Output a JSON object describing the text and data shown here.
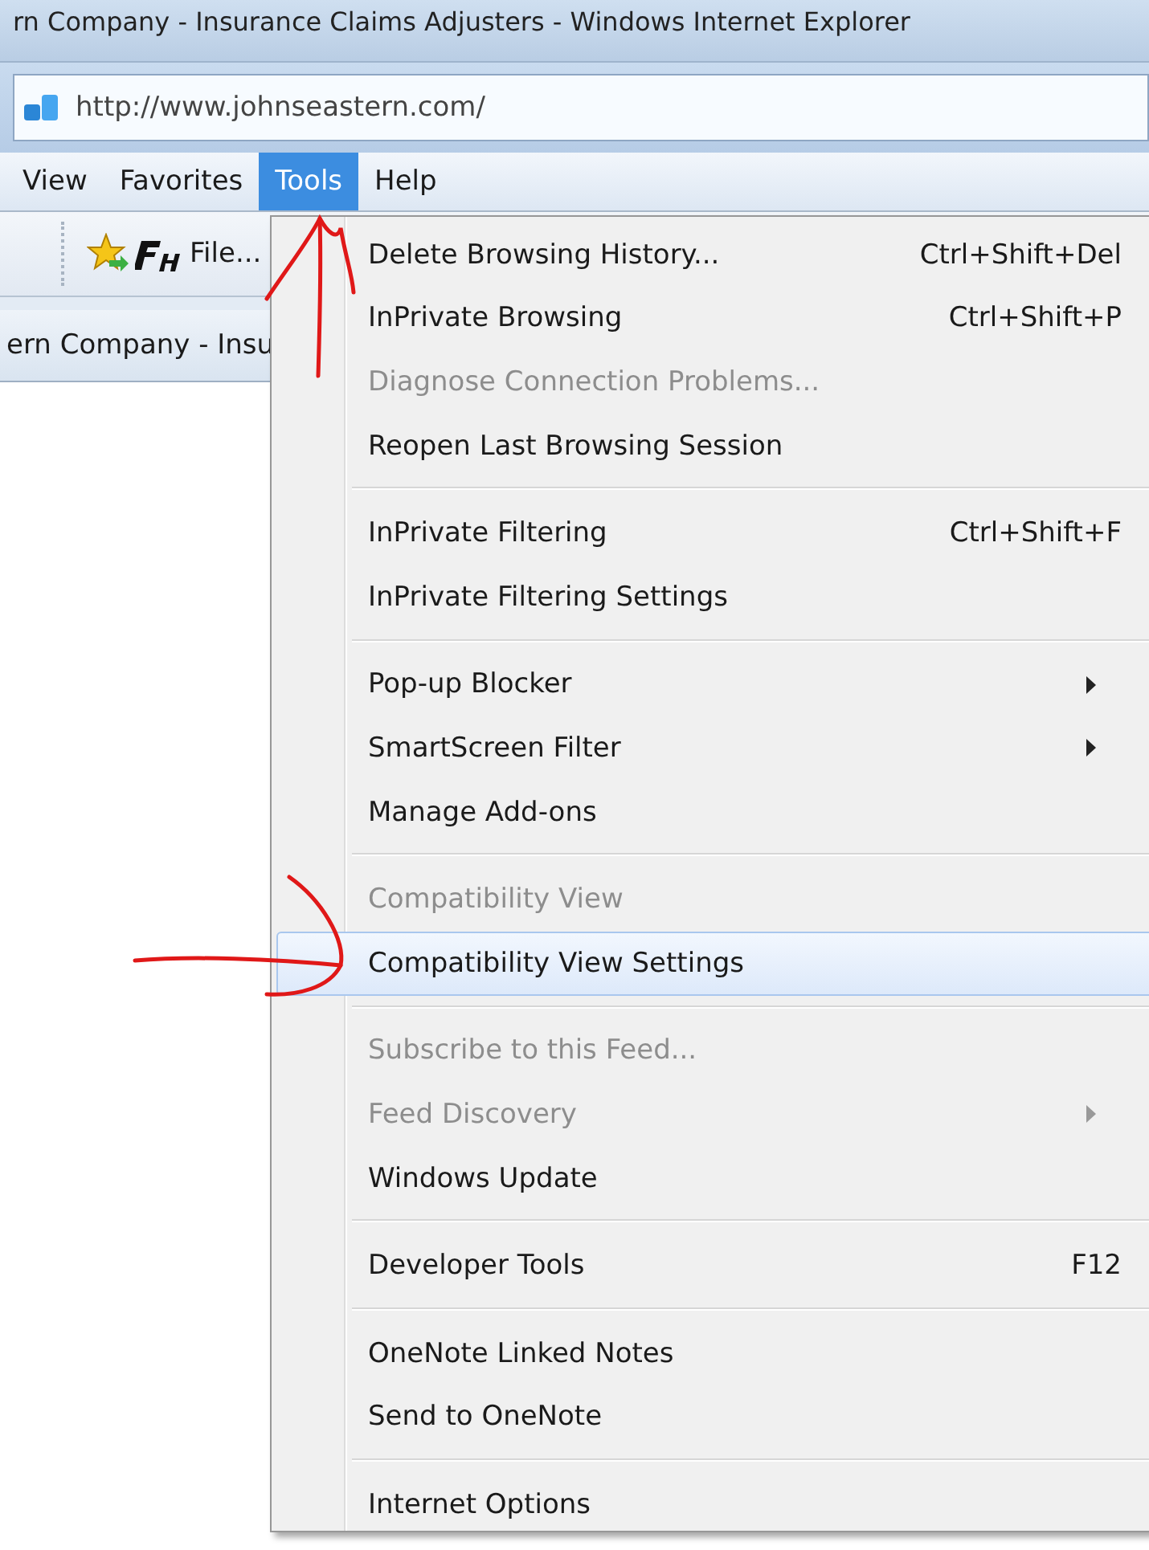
{
  "window": {
    "title": "rn Company - Insurance Claims Adjusters - Windows Internet Explorer"
  },
  "address_bar": {
    "url": "http://www.johnseastern.com/"
  },
  "menu_bar": [
    {
      "label": "View",
      "selected": false
    },
    {
      "label": "Favorites",
      "selected": false
    },
    {
      "label": "Tools",
      "selected": true
    },
    {
      "label": "Help",
      "selected": false
    }
  ],
  "toolbar": {
    "label": "File..."
  },
  "tab": {
    "title": "ern Company - Insu"
  },
  "tools_menu": [
    {
      "kind": "item",
      "label": "Delete Browsing History...",
      "shortcut": "Ctrl+Shift+Del",
      "disabled": false,
      "submenu": false,
      "selected": false
    },
    {
      "kind": "item",
      "label": "InPrivate Browsing",
      "shortcut": "Ctrl+Shift+P",
      "disabled": false,
      "submenu": false,
      "selected": false
    },
    {
      "kind": "item",
      "label": "Diagnose Connection Problems...",
      "disabled": true,
      "submenu": false,
      "selected": false
    },
    {
      "kind": "item",
      "label": "Reopen Last Browsing Session",
      "disabled": false,
      "submenu": false,
      "selected": false
    },
    {
      "kind": "separator"
    },
    {
      "kind": "item",
      "label": "InPrivate Filtering",
      "shortcut": "Ctrl+Shift+F",
      "disabled": false,
      "submenu": false,
      "selected": false
    },
    {
      "kind": "item",
      "label": "InPrivate Filtering Settings",
      "disabled": false,
      "submenu": false,
      "selected": false
    },
    {
      "kind": "separator"
    },
    {
      "kind": "item",
      "label": "Pop-up Blocker",
      "disabled": false,
      "submenu": true,
      "selected": false
    },
    {
      "kind": "item",
      "label": "SmartScreen Filter",
      "disabled": false,
      "submenu": true,
      "selected": false
    },
    {
      "kind": "item",
      "label": "Manage Add-ons",
      "disabled": false,
      "submenu": false,
      "selected": false
    },
    {
      "kind": "separator"
    },
    {
      "kind": "item",
      "label": "Compatibility View",
      "disabled": true,
      "submenu": false,
      "selected": false
    },
    {
      "kind": "item",
      "label": "Compatibility View Settings",
      "disabled": false,
      "submenu": false,
      "selected": true
    },
    {
      "kind": "separator"
    },
    {
      "kind": "item",
      "label": "Subscribe to this Feed...",
      "disabled": true,
      "submenu": false,
      "selected": false
    },
    {
      "kind": "item",
      "label": "Feed Discovery",
      "disabled": true,
      "submenu": true,
      "selected": false
    },
    {
      "kind": "item",
      "label": "Windows Update",
      "disabled": false,
      "submenu": false,
      "selected": false
    },
    {
      "kind": "separator"
    },
    {
      "kind": "item",
      "label": "Developer Tools",
      "shortcut": "F12",
      "disabled": false,
      "submenu": false,
      "selected": false
    },
    {
      "kind": "separator"
    },
    {
      "kind": "item",
      "label": "OneNote Linked Notes",
      "disabled": false,
      "submenu": false,
      "selected": false
    },
    {
      "kind": "item",
      "label": "Send to OneNote",
      "disabled": false,
      "submenu": false,
      "selected": false
    },
    {
      "kind": "separator"
    },
    {
      "kind": "item",
      "label": "Internet Options",
      "disabled": false,
      "submenu": false,
      "selected": false
    }
  ]
}
